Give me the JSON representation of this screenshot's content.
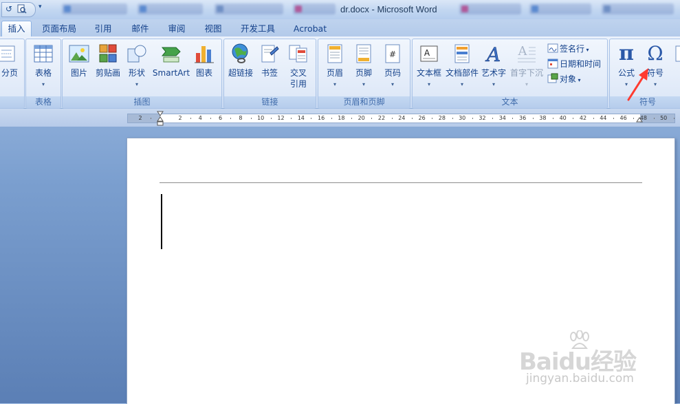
{
  "window": {
    "title": "dr.docx - Microsoft Word"
  },
  "tabs": [
    {
      "label": "插入",
      "active": true
    },
    {
      "label": "页面布局"
    },
    {
      "label": "引用"
    },
    {
      "label": "邮件"
    },
    {
      "label": "审阅"
    },
    {
      "label": "视图"
    },
    {
      "label": "开发工具"
    },
    {
      "label": "Acrobat"
    }
  ],
  "groups": {
    "pages": {
      "items": {
        "page_break": "分页"
      }
    },
    "table": {
      "label": "表格",
      "items": {
        "table": "表格"
      }
    },
    "illustrations": {
      "label": "插图",
      "items": {
        "picture": "图片",
        "clipart": "剪贴画",
        "shapes": "形状",
        "smartart": "SmartArt",
        "chart": "图表"
      }
    },
    "links": {
      "label": "链接",
      "items": {
        "hyperlink": "超链接",
        "bookmark": "书签",
        "crossref_1": "交叉",
        "crossref_2": "引用"
      }
    },
    "header_footer": {
      "label": "页眉和页脚",
      "items": {
        "header": "页眉",
        "footer": "页脚",
        "page_number": "页码"
      }
    },
    "text": {
      "label": "文本",
      "items": {
        "textbox": "文本框",
        "quickparts": "文档部件",
        "wordart": "艺术字",
        "dropcap": "首字下沉",
        "signature": "签名行",
        "datetime": "日期和时间",
        "object": "对象"
      }
    },
    "symbols": {
      "label": "符号",
      "items": {
        "equation": "公式",
        "symbol": "符号",
        "symbol_glyph": "Ω",
        "equation_glyph": "π"
      }
    }
  },
  "ruler": {
    "numbers": [
      "2",
      "2",
      "4",
      "6",
      "8",
      "10",
      "12",
      "14",
      "16",
      "18",
      "20",
      "22",
      "24",
      "26",
      "28",
      "30",
      "32",
      "34",
      "36",
      "38",
      "40",
      "42",
      "44",
      "46",
      "48",
      "50"
    ]
  },
  "watermark": {
    "brand": "Baidu经验",
    "url": "jingyan.baidu.com"
  },
  "colors": {
    "accent": "#15428b",
    "arrow": "#ff3b30"
  }
}
